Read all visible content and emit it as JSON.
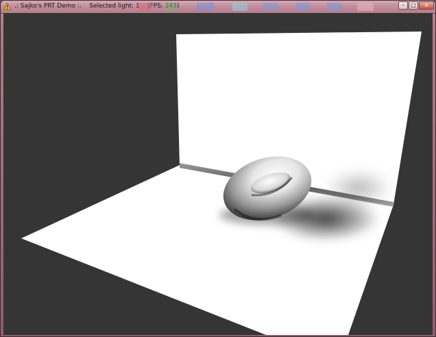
{
  "window": {
    "title": ".: Sajko's PRT Demo :.    Selected light: 1    (FPS: 243)",
    "controls": {
      "minimize": "–",
      "maximize": "□",
      "close": "×"
    }
  },
  "viewport": {
    "background_color": "#353535",
    "scene_elements": [
      "back-wall",
      "floor",
      "torus",
      "torus-shadow",
      "wall-shadow",
      "corner-seam"
    ]
  },
  "colors": {
    "titlebar": "#c38f9e",
    "frame": "#8d5e6c",
    "wall": "#ffffff"
  }
}
